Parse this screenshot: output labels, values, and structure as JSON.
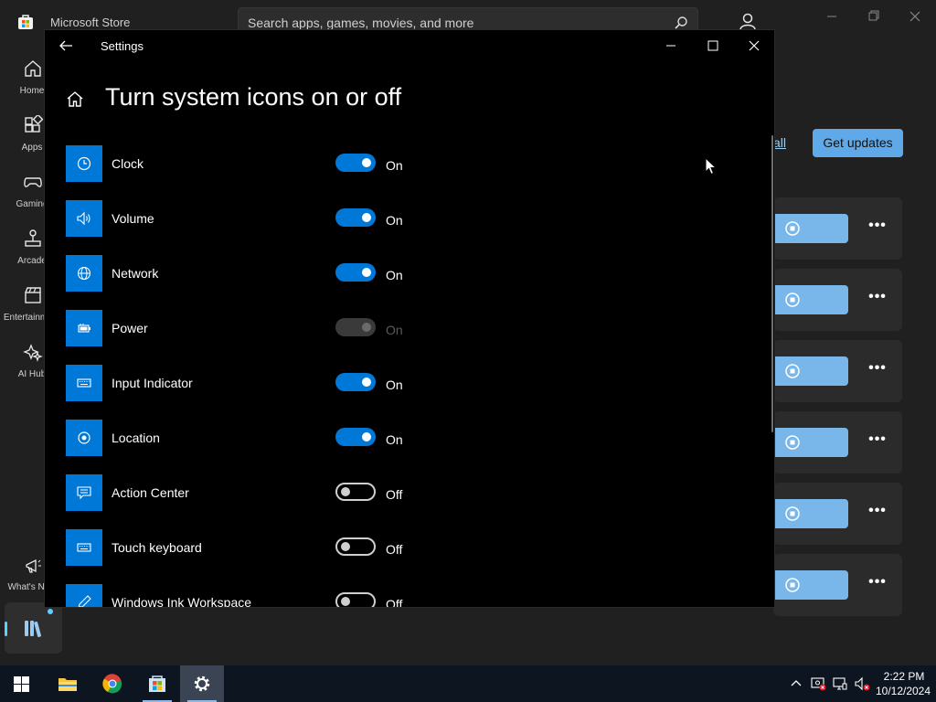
{
  "store": {
    "app_title": "Microsoft Store",
    "search_placeholder": "Search apps, games, movies, and more",
    "nav": [
      {
        "label": "Home",
        "icon": "home-icon"
      },
      {
        "label": "Apps",
        "icon": "apps-icon"
      },
      {
        "label": "Gaming",
        "icon": "gaming-icon"
      },
      {
        "label": "Arcade",
        "icon": "arcade-icon"
      },
      {
        "label": "Entertainment",
        "icon": "entertainment-icon"
      },
      {
        "label": "AI Hub",
        "icon": "ai-hub-icon"
      }
    ],
    "whats_new_label": "What's New",
    "update_all_label": "all",
    "get_updates_label": "Get updates",
    "more_label": "•••"
  },
  "settings": {
    "window_title": "Settings",
    "page_title": "Turn system icons on or off",
    "items": [
      {
        "label": "Clock",
        "icon": "clock-icon",
        "state": "On",
        "on": true,
        "enabled": true
      },
      {
        "label": "Volume",
        "icon": "volume-icon",
        "state": "On",
        "on": true,
        "enabled": true
      },
      {
        "label": "Network",
        "icon": "network-globe-icon",
        "state": "On",
        "on": true,
        "enabled": true
      },
      {
        "label": "Power",
        "icon": "battery-icon",
        "state": "On",
        "on": true,
        "enabled": false
      },
      {
        "label": "Input Indicator",
        "icon": "keyboard-icon",
        "state": "On",
        "on": true,
        "enabled": true
      },
      {
        "label": "Location",
        "icon": "location-icon",
        "state": "On",
        "on": true,
        "enabled": true
      },
      {
        "label": "Action Center",
        "icon": "action-center-icon",
        "state": "Off",
        "on": false,
        "enabled": true
      },
      {
        "label": "Touch keyboard",
        "icon": "touch-keyboard-icon",
        "state": "Off",
        "on": false,
        "enabled": true
      },
      {
        "label": "Windows Ink Workspace",
        "icon": "pen-icon",
        "state": "Off",
        "on": false,
        "enabled": true
      }
    ]
  },
  "taskbar": {
    "apps": [
      "file-explorer-icon",
      "chrome-icon",
      "microsoft-store-icon",
      "settings-gear-icon"
    ],
    "time": "2:22 PM",
    "date": "10/12/2024"
  },
  "colors": {
    "accent": "#0078d7",
    "store_accent": "#60a9e8"
  }
}
